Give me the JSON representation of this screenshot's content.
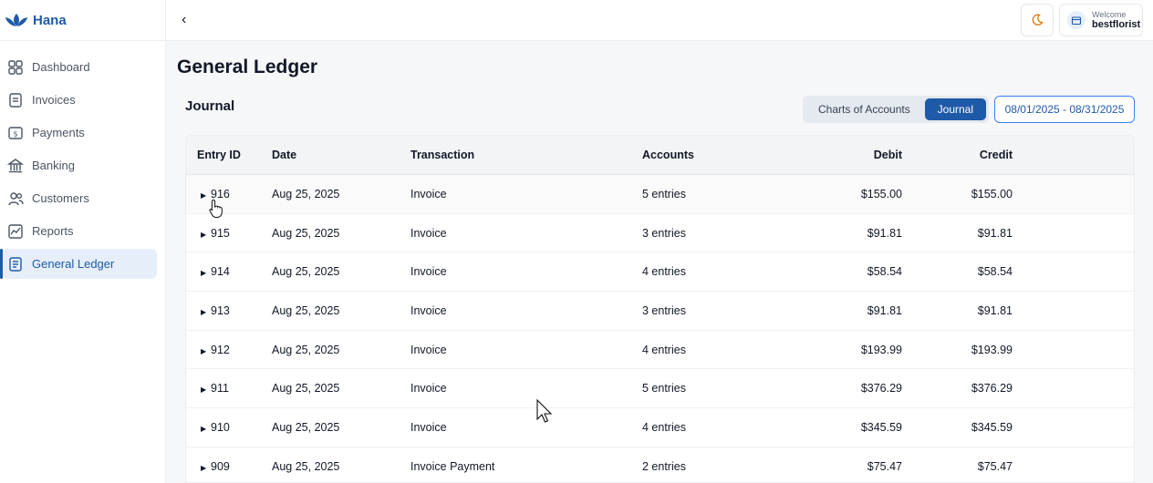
{
  "app": {
    "name": "Hana"
  },
  "sidebar": {
    "items": [
      {
        "label": "Dashboard",
        "icon": "dashboard-icon"
      },
      {
        "label": "Invoices",
        "icon": "invoice-icon"
      },
      {
        "label": "Payments",
        "icon": "payments-icon"
      },
      {
        "label": "Banking",
        "icon": "bank-icon"
      },
      {
        "label": "Customers",
        "icon": "customers-icon"
      },
      {
        "label": "Reports",
        "icon": "reports-icon"
      },
      {
        "label": "General Ledger",
        "icon": "ledger-icon",
        "active": true
      }
    ]
  },
  "header": {
    "back": "‹",
    "welcome": "Welcome",
    "username": "bestflorist"
  },
  "page": {
    "title": "General Ledger",
    "section": "Journal",
    "view_toggle": {
      "charts": "Charts of Accounts",
      "journal": "Journal",
      "selected": "Journal"
    },
    "date_range": "08/01/2025 - 08/31/2025"
  },
  "table": {
    "headers": {
      "id": "Entry ID",
      "date": "Date",
      "transaction": "Transaction",
      "accounts": "Accounts",
      "debit": "Debit",
      "credit": "Credit"
    },
    "rows": [
      {
        "id": "916",
        "date": "Aug 25, 2025",
        "transaction": "Invoice",
        "accounts": "5 entries",
        "debit": "$155.00",
        "credit": "$155.00"
      },
      {
        "id": "915",
        "date": "Aug 25, 2025",
        "transaction": "Invoice",
        "accounts": "3 entries",
        "debit": "$91.81",
        "credit": "$91.81"
      },
      {
        "id": "914",
        "date": "Aug 25, 2025",
        "transaction": "Invoice",
        "accounts": "4 entries",
        "debit": "$58.54",
        "credit": "$58.54"
      },
      {
        "id": "913",
        "date": "Aug 25, 2025",
        "transaction": "Invoice",
        "accounts": "3 entries",
        "debit": "$91.81",
        "credit": "$91.81"
      },
      {
        "id": "912",
        "date": "Aug 25, 2025",
        "transaction": "Invoice",
        "accounts": "4 entries",
        "debit": "$193.99",
        "credit": "$193.99"
      },
      {
        "id": "911",
        "date": "Aug 25, 2025",
        "transaction": "Invoice",
        "accounts": "5 entries",
        "debit": "$376.29",
        "credit": "$376.29"
      },
      {
        "id": "910",
        "date": "Aug 25, 2025",
        "transaction": "Invoice",
        "accounts": "4 entries",
        "debit": "$345.59",
        "credit": "$345.59"
      },
      {
        "id": "909",
        "date": "Aug 25, 2025",
        "transaction": "Invoice Payment",
        "accounts": "2 entries",
        "debit": "$75.47",
        "credit": "$75.47"
      }
    ]
  },
  "colors": {
    "accent": "#1e5aa8",
    "active_bg": "#e6eef9",
    "border": "#3b82f6"
  }
}
